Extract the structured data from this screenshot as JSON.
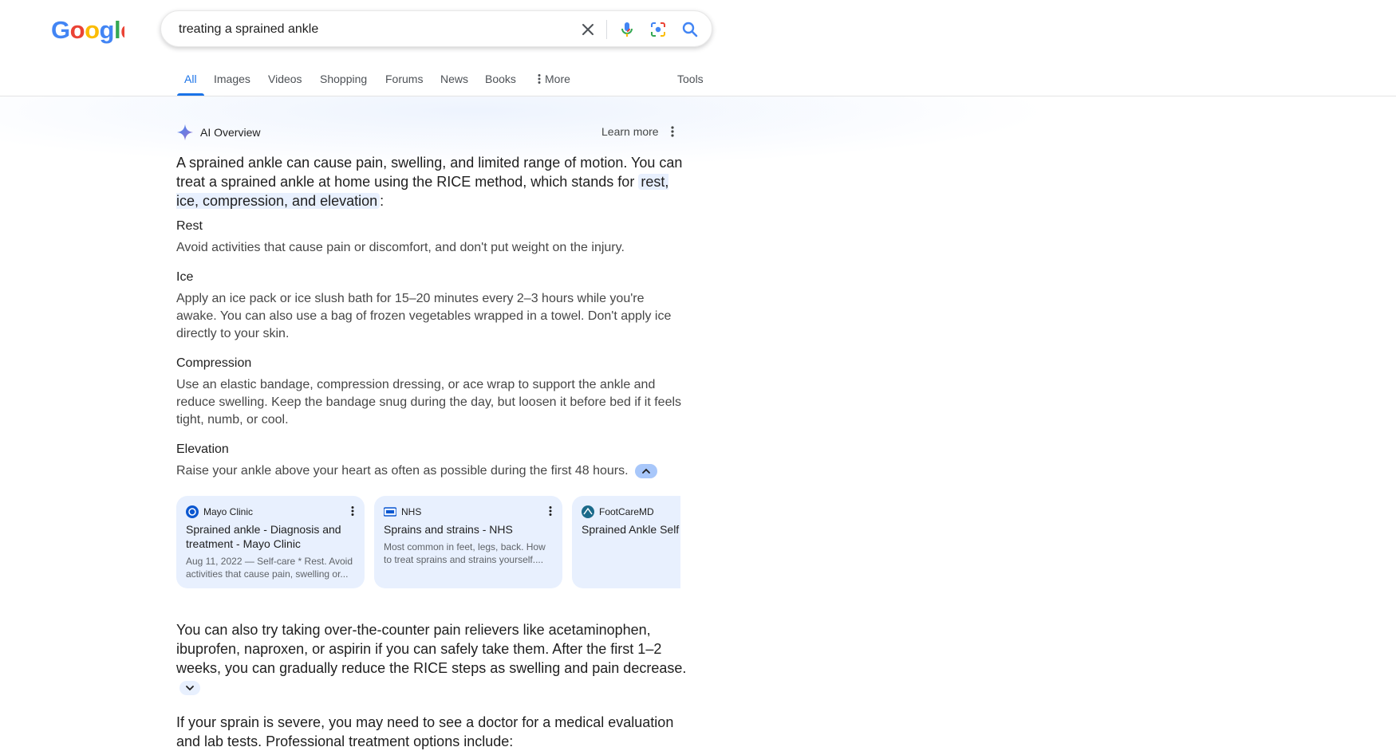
{
  "logo": {
    "text": "Google",
    "colors": [
      "#4285F4",
      "#EA4335",
      "#FBBC05",
      "#4285F4",
      "#34A853",
      "#EA4335"
    ]
  },
  "search": {
    "query": "treating a sprained ankle"
  },
  "tabs": [
    {
      "label": "All",
      "active": true
    },
    {
      "label": "Images"
    },
    {
      "label": "Videos"
    },
    {
      "label": "Shopping"
    },
    {
      "label": "Forums"
    },
    {
      "label": "News"
    },
    {
      "label": "Books"
    },
    {
      "label": "More"
    }
  ],
  "tools_label": "Tools",
  "ai_overview": {
    "title": "AI Overview",
    "learn_more": "Learn more",
    "lead_text": "A sprained ankle can cause pain, swelling, and limited range of motion. You can treat a sprained ankle at home using the RICE method, which stands for",
    "lead_highlight": "rest, ice, compression, and elevation",
    "lead_end": ":",
    "sections": [
      {
        "title": "Rest",
        "body": "Avoid activities that cause pain or discomfort, and don't put weight on the injury."
      },
      {
        "title": "Ice",
        "body": "Apply an ice pack or ice slush bath for 15–20 minutes every 2–3 hours while you're awake. You can also use a bag of frozen vegetables wrapped in a towel. Don't apply ice directly to your skin."
      },
      {
        "title": "Compression",
        "body": "Use an elastic bandage, compression dressing, or ace wrap to support the ankle and reduce swelling. Keep the bandage snug during the day, but loosen it before bed if it feels tight, numb, or cool."
      },
      {
        "title": "Elevation",
        "body": "Raise your ankle above your heart as often as possible during the first 48 hours."
      }
    ],
    "sources": [
      {
        "site": "Mayo Clinic",
        "title": "Sprained ankle - Diagnosis and treatment - Mayo Clinic",
        "snippet": "Aug 11, 2022 — Self-care * Rest. Avoid activities that cause pain, swelling or..."
      },
      {
        "site": "NHS",
        "title": "Sprains and strains - NHS",
        "snippet": "Most common in feet, legs, back. How to treat sprains and strains yourself...."
      },
      {
        "site": "FootCareMD",
        "title": "Sprained Ankle Self Treatment | FootCareMD",
        "snippet": ""
      }
    ],
    "para1": "You can also try taking over-the-counter pain relievers like acetaminophen, ibuprofen, naproxen, or aspirin if you can safely take them. After the first 1–2 weeks, you can gradually reduce the RICE steps as swelling and pain decrease.",
    "para2": "If your sprain is severe, you may need to see a doctor for a medical evaluation and lab tests. Professional treatment options include:"
  }
}
